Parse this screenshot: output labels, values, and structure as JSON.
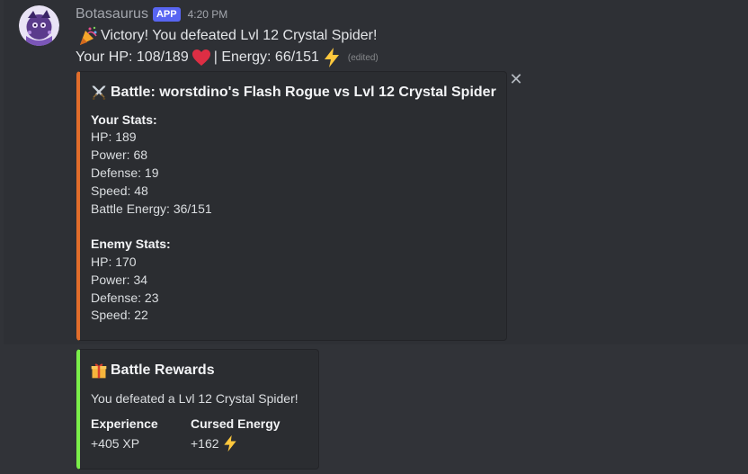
{
  "message": {
    "username": "Botasaurus",
    "badge": "APP",
    "timestamp": "4:20 PM",
    "line1": "Victory! You defeated Lvl 12 Crystal Spider!",
    "line2_hp": "Your HP: 108/189",
    "line2_energy": "| Energy: 66/151",
    "edited": "(edited)",
    "icons": {
      "line1": "party-popper-icon",
      "hp": "red-heart-icon",
      "energy": "lightning-icon"
    }
  },
  "battle_embed": {
    "accent": "#e16d2b",
    "title": "Battle: worstdino's Flash Rogue vs Lvl 12 Crystal Spider",
    "title_icon": "crossed-swords-icon",
    "your_stats_title": "Your Stats:",
    "your_stats": [
      "HP: 189",
      "Power: 68",
      "Defense: 19",
      "Speed: 48",
      "Battle Energy: 36/151"
    ],
    "enemy_stats_title": "Enemy Stats:",
    "enemy_stats": [
      "HP: 170",
      "Power: 34",
      "Defense: 23",
      "Speed: 22"
    ]
  },
  "rewards_embed": {
    "accent": "#7bee4a",
    "title": "Battle Rewards",
    "title_icon": "gift-icon",
    "description": "You defeated a Lvl 12 Crystal Spider!",
    "fields": [
      {
        "name": "Experience",
        "value": "+405 XP"
      },
      {
        "name": "Cursed Energy",
        "value": "+162",
        "icon": "lightning-icon"
      }
    ]
  }
}
